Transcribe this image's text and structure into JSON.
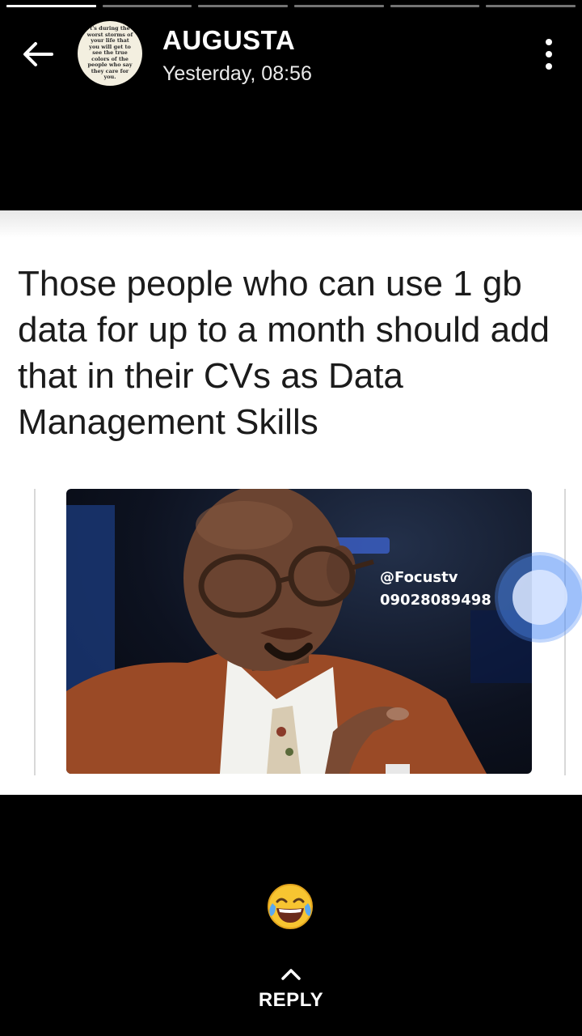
{
  "status": {
    "segments": [
      {
        "progress": 1.0
      },
      {
        "progress": 0.0
      },
      {
        "progress": 0.0
      },
      {
        "progress": 0.0
      },
      {
        "progress": 0.0
      },
      {
        "progress": 0.0
      }
    ]
  },
  "header": {
    "contact_name": "AUGUSTA",
    "timestamp": "Yesterday, 08:56",
    "avatar_text": "t's during the worst storms of your life that you will get to see the true colors of the people who say they care for you."
  },
  "post": {
    "caption": "Those people who can use 1 gb data for up to a month should add that in their CVs as Data Management Skills",
    "watermark_handle": "@Focustv",
    "watermark_phone": "09028089498"
  },
  "reaction": {
    "emoji": "😂"
  },
  "footer": {
    "reply_label": "REPLY"
  },
  "icons": {
    "back": "back-arrow-icon",
    "menu": "more-vert-icon",
    "reply": "chevron-up-icon"
  },
  "colors": {
    "background": "#000000",
    "touch_indicator": "#4f8cf5"
  }
}
